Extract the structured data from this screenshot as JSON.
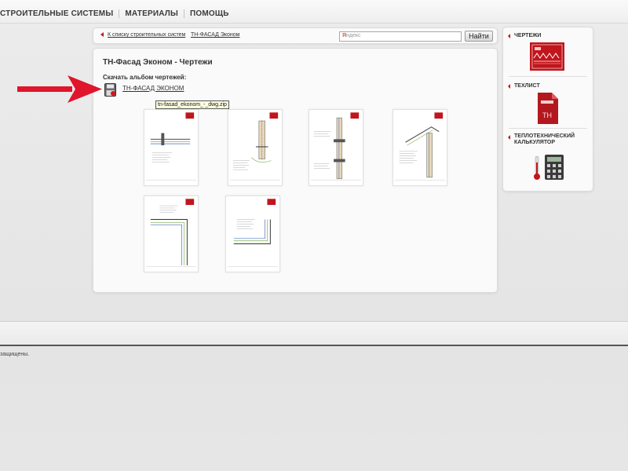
{
  "topnav": {
    "items": [
      "СТРОИТЕЛЬНЫЕ СИСТЕМЫ",
      "МАТЕРИАЛЫ",
      "ПОМОЩЬ"
    ]
  },
  "breadcrumb": {
    "back_link": "К списку строительных систем",
    "current": "ТН-ФАСАД Эконом"
  },
  "search": {
    "placeholder_logo_first": "Я",
    "placeholder_logo_rest": "ндекс",
    "button_label": "Найти"
  },
  "main": {
    "title": "ТН-Фасад Эконом - Чертежи",
    "download_label": "Скачать альбом чертежей:",
    "download_link": "ТН-ФАСАД ЭКОНОМ",
    "tooltip": "tn-fasad_ekonom_-_dwg.zip"
  },
  "sidebar": {
    "items": [
      {
        "label_line1": "ЧЕРТЕЖИ",
        "label_line2": "",
        "icon": "drawings-icon"
      },
      {
        "label_line1": "ТЕХЛИСТ",
        "label_line2": "",
        "icon": "techlist-icon"
      },
      {
        "label_line1": "ТЕПЛОТЕХНИЧЕСКИЙ",
        "label_line2": "КАЛЬКУЛЯТОР",
        "icon": "calculator-icon"
      }
    ],
    "techlist_badge": "ТН"
  },
  "footer": {
    "copyright": "защищены."
  },
  "colors": {
    "accent_red": "#c0161c",
    "arrow_red": "#e0142a"
  }
}
